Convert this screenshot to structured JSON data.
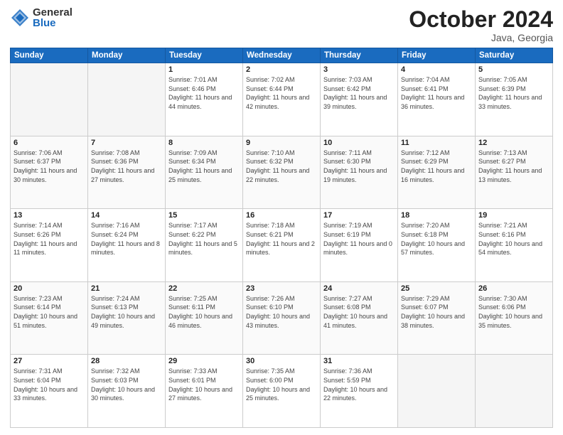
{
  "logo": {
    "general": "General",
    "blue": "Blue"
  },
  "header": {
    "month": "October 2024",
    "location": "Java, Georgia"
  },
  "weekdays": [
    "Sunday",
    "Monday",
    "Tuesday",
    "Wednesday",
    "Thursday",
    "Friday",
    "Saturday"
  ],
  "weeks": [
    [
      {
        "day": "",
        "info": ""
      },
      {
        "day": "",
        "info": ""
      },
      {
        "day": "1",
        "info": "Sunrise: 7:01 AM\nSunset: 6:46 PM\nDaylight: 11 hours and 44 minutes."
      },
      {
        "day": "2",
        "info": "Sunrise: 7:02 AM\nSunset: 6:44 PM\nDaylight: 11 hours and 42 minutes."
      },
      {
        "day": "3",
        "info": "Sunrise: 7:03 AM\nSunset: 6:42 PM\nDaylight: 11 hours and 39 minutes."
      },
      {
        "day": "4",
        "info": "Sunrise: 7:04 AM\nSunset: 6:41 PM\nDaylight: 11 hours and 36 minutes."
      },
      {
        "day": "5",
        "info": "Sunrise: 7:05 AM\nSunset: 6:39 PM\nDaylight: 11 hours and 33 minutes."
      }
    ],
    [
      {
        "day": "6",
        "info": "Sunrise: 7:06 AM\nSunset: 6:37 PM\nDaylight: 11 hours and 30 minutes."
      },
      {
        "day": "7",
        "info": "Sunrise: 7:08 AM\nSunset: 6:36 PM\nDaylight: 11 hours and 27 minutes."
      },
      {
        "day": "8",
        "info": "Sunrise: 7:09 AM\nSunset: 6:34 PM\nDaylight: 11 hours and 25 minutes."
      },
      {
        "day": "9",
        "info": "Sunrise: 7:10 AM\nSunset: 6:32 PM\nDaylight: 11 hours and 22 minutes."
      },
      {
        "day": "10",
        "info": "Sunrise: 7:11 AM\nSunset: 6:30 PM\nDaylight: 11 hours and 19 minutes."
      },
      {
        "day": "11",
        "info": "Sunrise: 7:12 AM\nSunset: 6:29 PM\nDaylight: 11 hours and 16 minutes."
      },
      {
        "day": "12",
        "info": "Sunrise: 7:13 AM\nSunset: 6:27 PM\nDaylight: 11 hours and 13 minutes."
      }
    ],
    [
      {
        "day": "13",
        "info": "Sunrise: 7:14 AM\nSunset: 6:26 PM\nDaylight: 11 hours and 11 minutes."
      },
      {
        "day": "14",
        "info": "Sunrise: 7:16 AM\nSunset: 6:24 PM\nDaylight: 11 hours and 8 minutes."
      },
      {
        "day": "15",
        "info": "Sunrise: 7:17 AM\nSunset: 6:22 PM\nDaylight: 11 hours and 5 minutes."
      },
      {
        "day": "16",
        "info": "Sunrise: 7:18 AM\nSunset: 6:21 PM\nDaylight: 11 hours and 2 minutes."
      },
      {
        "day": "17",
        "info": "Sunrise: 7:19 AM\nSunset: 6:19 PM\nDaylight: 11 hours and 0 minutes."
      },
      {
        "day": "18",
        "info": "Sunrise: 7:20 AM\nSunset: 6:18 PM\nDaylight: 10 hours and 57 minutes."
      },
      {
        "day": "19",
        "info": "Sunrise: 7:21 AM\nSunset: 6:16 PM\nDaylight: 10 hours and 54 minutes."
      }
    ],
    [
      {
        "day": "20",
        "info": "Sunrise: 7:23 AM\nSunset: 6:14 PM\nDaylight: 10 hours and 51 minutes."
      },
      {
        "day": "21",
        "info": "Sunrise: 7:24 AM\nSunset: 6:13 PM\nDaylight: 10 hours and 49 minutes."
      },
      {
        "day": "22",
        "info": "Sunrise: 7:25 AM\nSunset: 6:11 PM\nDaylight: 10 hours and 46 minutes."
      },
      {
        "day": "23",
        "info": "Sunrise: 7:26 AM\nSunset: 6:10 PM\nDaylight: 10 hours and 43 minutes."
      },
      {
        "day": "24",
        "info": "Sunrise: 7:27 AM\nSunset: 6:08 PM\nDaylight: 10 hours and 41 minutes."
      },
      {
        "day": "25",
        "info": "Sunrise: 7:29 AM\nSunset: 6:07 PM\nDaylight: 10 hours and 38 minutes."
      },
      {
        "day": "26",
        "info": "Sunrise: 7:30 AM\nSunset: 6:06 PM\nDaylight: 10 hours and 35 minutes."
      }
    ],
    [
      {
        "day": "27",
        "info": "Sunrise: 7:31 AM\nSunset: 6:04 PM\nDaylight: 10 hours and 33 minutes."
      },
      {
        "day": "28",
        "info": "Sunrise: 7:32 AM\nSunset: 6:03 PM\nDaylight: 10 hours and 30 minutes."
      },
      {
        "day": "29",
        "info": "Sunrise: 7:33 AM\nSunset: 6:01 PM\nDaylight: 10 hours and 27 minutes."
      },
      {
        "day": "30",
        "info": "Sunrise: 7:35 AM\nSunset: 6:00 PM\nDaylight: 10 hours and 25 minutes."
      },
      {
        "day": "31",
        "info": "Sunrise: 7:36 AM\nSunset: 5:59 PM\nDaylight: 10 hours and 22 minutes."
      },
      {
        "day": "",
        "info": ""
      },
      {
        "day": "",
        "info": ""
      }
    ]
  ]
}
